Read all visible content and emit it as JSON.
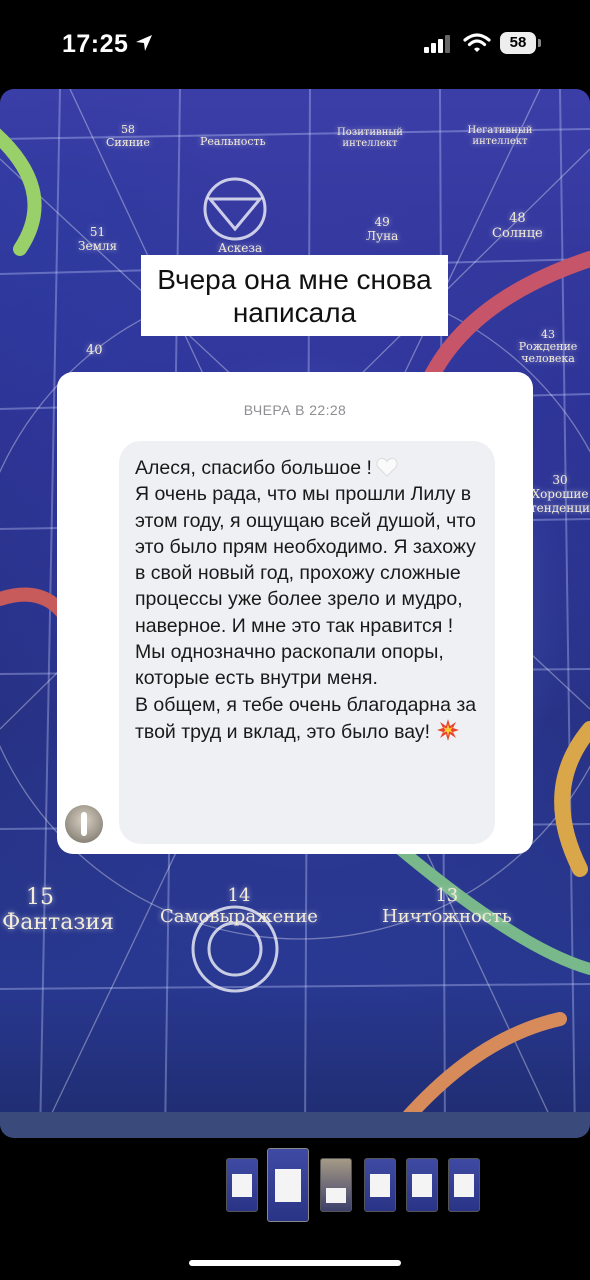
{
  "status_bar": {
    "time": "17:25",
    "battery": "58"
  },
  "story": {
    "caption": "Вчера она мне снова написала",
    "board_labels": [
      {
        "num": "58",
        "text": "Сияние"
      },
      {
        "num": "",
        "text": "Реальность"
      },
      {
        "num": "",
        "text": "Позитивный интеллект"
      },
      {
        "num": "",
        "text": "Негативный интеллект"
      },
      {
        "num": "51",
        "text": "Земля"
      },
      {
        "num": "",
        "text": "Аскеза"
      },
      {
        "num": "49",
        "text": "Луна"
      },
      {
        "num": "48",
        "text": "Солнце"
      },
      {
        "num": "40",
        "text": ""
      },
      {
        "num": "43",
        "text": "Рождение человека"
      },
      {
        "num": "30",
        "text": "Хорошие тенденции"
      },
      {
        "num": "15",
        "text": "Фантазия"
      },
      {
        "num": "14",
        "text": "Самовыражение"
      },
      {
        "num": "13",
        "text": "Ничтожность"
      }
    ]
  },
  "card": {
    "date": "ВЧЕРА В 22:28",
    "message": {
      "line1": "Алеся, спасибо большое !",
      "para1": "Я очень рада, что мы прошли Лилу в этом году, я ощущаю всей душой, что это было прям необходимо. Я захожу в свой новый год, прохожу сложные процессы уже более зрело и мудро, наверное. И мне это так нравится ! Мы однозначно раскопали опоры, которые есть внутри меня.",
      "para2": "В общем, я тебе очень благодарна за твой труд и вклад, это было вау!"
    }
  },
  "thumbnails": {
    "count": 6,
    "active_index": 1
  },
  "colors": {
    "board_bg": "#2d3394",
    "card_bg": "#ffffff",
    "bubble_bg": "#eff0f3",
    "date_gray": "#8e8e93"
  }
}
